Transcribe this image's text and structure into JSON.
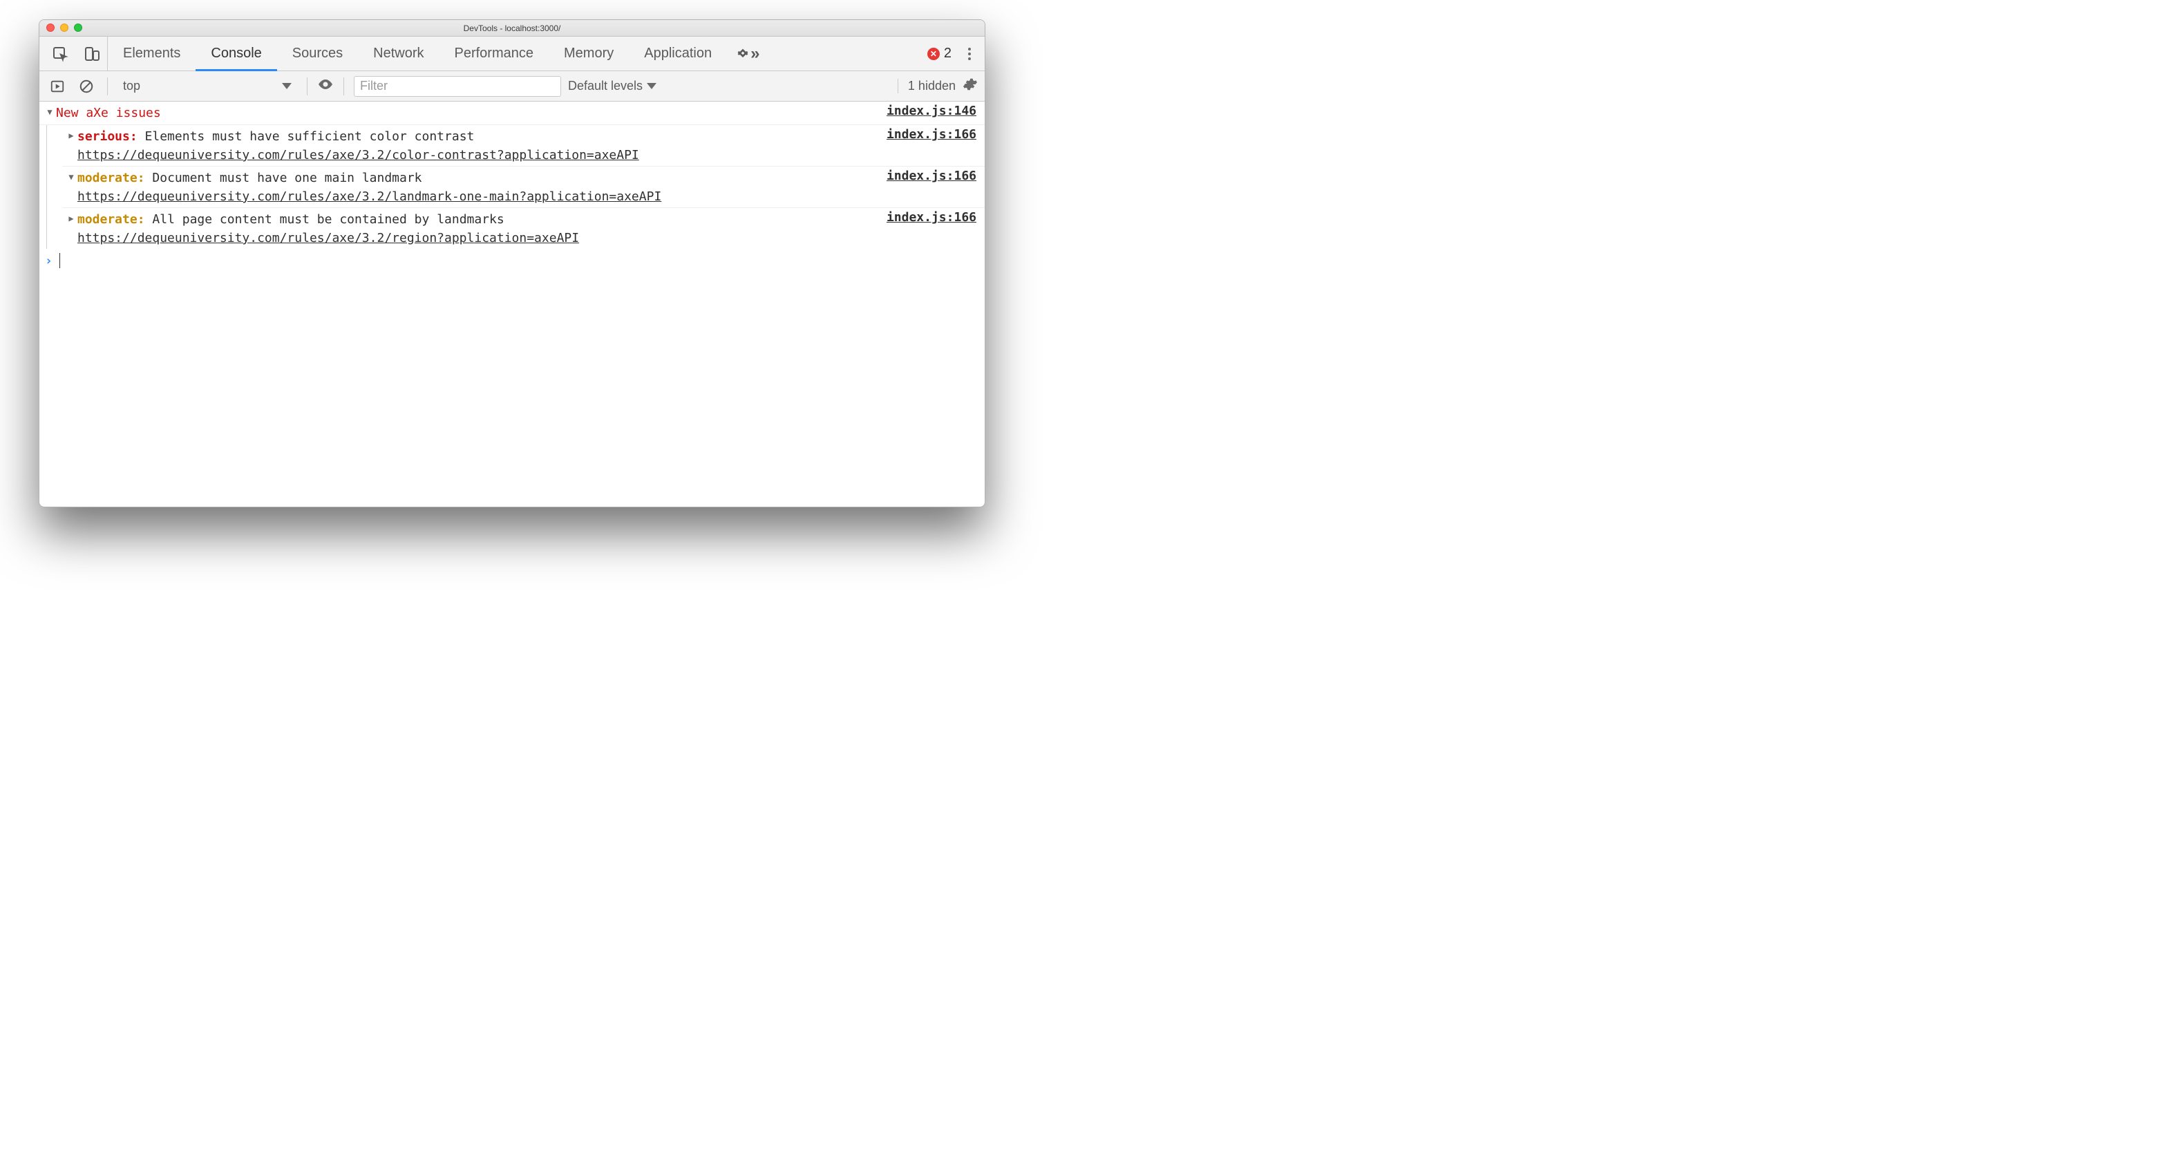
{
  "window": {
    "title": "DevTools - localhost:3000/"
  },
  "tabs": {
    "items": [
      "Elements",
      "Console",
      "Sources",
      "Network",
      "Performance",
      "Memory",
      "Application"
    ],
    "active_index": 1,
    "error_count": "2"
  },
  "consolebar": {
    "context": "top",
    "filter_placeholder": "Filter",
    "levels_label": "Default levels",
    "hidden_text": "1 hidden"
  },
  "group": {
    "title": "New aXe issues",
    "source": "index.js:146"
  },
  "issues": [
    {
      "expanded": false,
      "severity": "serious",
      "severity_label": "serious:",
      "message": "Elements must have sufficient color contrast",
      "url": "https://dequeuniversity.com/rules/axe/3.2/color-contrast?application=axeAPI",
      "source": "index.js:166"
    },
    {
      "expanded": true,
      "severity": "moderate",
      "severity_label": "moderate:",
      "message": "Document must have one main landmark",
      "url": "https://dequeuniversity.com/rules/axe/3.2/landmark-one-main?application=axeAPI",
      "source": "index.js:166"
    },
    {
      "expanded": false,
      "severity": "moderate",
      "severity_label": "moderate:",
      "message": "All page content must be contained by landmarks",
      "url": "https://dequeuniversity.com/rules/axe/3.2/region?application=axeAPI",
      "source": "index.js:166"
    }
  ]
}
